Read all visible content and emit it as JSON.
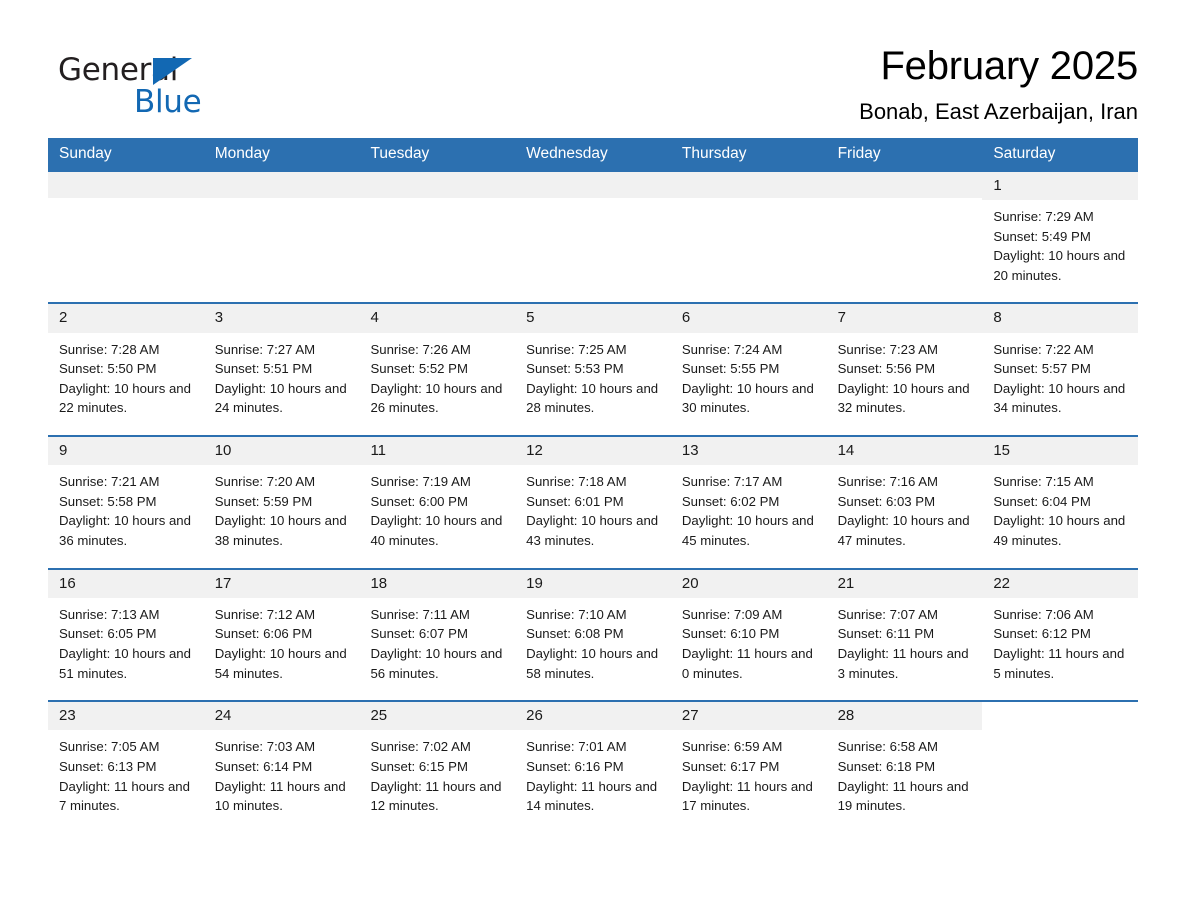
{
  "brand": {
    "name_part1": "General",
    "name_part2": "Blue",
    "triangle_icon": "triangle-icon",
    "accent_color": "#1268b3"
  },
  "header": {
    "title": "February 2025",
    "subtitle": "Bonab, East Azerbaijan, Iran"
  },
  "colors": {
    "header_blue": "#2c70b0",
    "day_number_band": "#f1f1f1",
    "text": "#1a1a1a"
  },
  "labels": {
    "sunrise_prefix": "Sunrise:",
    "sunset_prefix": "Sunset:",
    "daylight_prefix": "Daylight:"
  },
  "weekdays": [
    "Sunday",
    "Monday",
    "Tuesday",
    "Wednesday",
    "Thursday",
    "Friday",
    "Saturday"
  ],
  "weeks": [
    [
      {
        "day": "",
        "sunrise": "",
        "sunset": "",
        "daylight": ""
      },
      {
        "day": "",
        "sunrise": "",
        "sunset": "",
        "daylight": ""
      },
      {
        "day": "",
        "sunrise": "",
        "sunset": "",
        "daylight": ""
      },
      {
        "day": "",
        "sunrise": "",
        "sunset": "",
        "daylight": ""
      },
      {
        "day": "",
        "sunrise": "",
        "sunset": "",
        "daylight": ""
      },
      {
        "day": "",
        "sunrise": "",
        "sunset": "",
        "daylight": ""
      },
      {
        "day": "1",
        "sunrise": "Sunrise: 7:29 AM",
        "sunset": "Sunset: 5:49 PM",
        "daylight": "Daylight: 10 hours and 20 minutes."
      }
    ],
    [
      {
        "day": "2",
        "sunrise": "Sunrise: 7:28 AM",
        "sunset": "Sunset: 5:50 PM",
        "daylight": "Daylight: 10 hours and 22 minutes."
      },
      {
        "day": "3",
        "sunrise": "Sunrise: 7:27 AM",
        "sunset": "Sunset: 5:51 PM",
        "daylight": "Daylight: 10 hours and 24 minutes."
      },
      {
        "day": "4",
        "sunrise": "Sunrise: 7:26 AM",
        "sunset": "Sunset: 5:52 PM",
        "daylight": "Daylight: 10 hours and 26 minutes."
      },
      {
        "day": "5",
        "sunrise": "Sunrise: 7:25 AM",
        "sunset": "Sunset: 5:53 PM",
        "daylight": "Daylight: 10 hours and 28 minutes."
      },
      {
        "day": "6",
        "sunrise": "Sunrise: 7:24 AM",
        "sunset": "Sunset: 5:55 PM",
        "daylight": "Daylight: 10 hours and 30 minutes."
      },
      {
        "day": "7",
        "sunrise": "Sunrise: 7:23 AM",
        "sunset": "Sunset: 5:56 PM",
        "daylight": "Daylight: 10 hours and 32 minutes."
      },
      {
        "day": "8",
        "sunrise": "Sunrise: 7:22 AM",
        "sunset": "Sunset: 5:57 PM",
        "daylight": "Daylight: 10 hours and 34 minutes."
      }
    ],
    [
      {
        "day": "9",
        "sunrise": "Sunrise: 7:21 AM",
        "sunset": "Sunset: 5:58 PM",
        "daylight": "Daylight: 10 hours and 36 minutes."
      },
      {
        "day": "10",
        "sunrise": "Sunrise: 7:20 AM",
        "sunset": "Sunset: 5:59 PM",
        "daylight": "Daylight: 10 hours and 38 minutes."
      },
      {
        "day": "11",
        "sunrise": "Sunrise: 7:19 AM",
        "sunset": "Sunset: 6:00 PM",
        "daylight": "Daylight: 10 hours and 40 minutes."
      },
      {
        "day": "12",
        "sunrise": "Sunrise: 7:18 AM",
        "sunset": "Sunset: 6:01 PM",
        "daylight": "Daylight: 10 hours and 43 minutes."
      },
      {
        "day": "13",
        "sunrise": "Sunrise: 7:17 AM",
        "sunset": "Sunset: 6:02 PM",
        "daylight": "Daylight: 10 hours and 45 minutes."
      },
      {
        "day": "14",
        "sunrise": "Sunrise: 7:16 AM",
        "sunset": "Sunset: 6:03 PM",
        "daylight": "Daylight: 10 hours and 47 minutes."
      },
      {
        "day": "15",
        "sunrise": "Sunrise: 7:15 AM",
        "sunset": "Sunset: 6:04 PM",
        "daylight": "Daylight: 10 hours and 49 minutes."
      }
    ],
    [
      {
        "day": "16",
        "sunrise": "Sunrise: 7:13 AM",
        "sunset": "Sunset: 6:05 PM",
        "daylight": "Daylight: 10 hours and 51 minutes."
      },
      {
        "day": "17",
        "sunrise": "Sunrise: 7:12 AM",
        "sunset": "Sunset: 6:06 PM",
        "daylight": "Daylight: 10 hours and 54 minutes."
      },
      {
        "day": "18",
        "sunrise": "Sunrise: 7:11 AM",
        "sunset": "Sunset: 6:07 PM",
        "daylight": "Daylight: 10 hours and 56 minutes."
      },
      {
        "day": "19",
        "sunrise": "Sunrise: 7:10 AM",
        "sunset": "Sunset: 6:08 PM",
        "daylight": "Daylight: 10 hours and 58 minutes."
      },
      {
        "day": "20",
        "sunrise": "Sunrise: 7:09 AM",
        "sunset": "Sunset: 6:10 PM",
        "daylight": "Daylight: 11 hours and 0 minutes."
      },
      {
        "day": "21",
        "sunrise": "Sunrise: 7:07 AM",
        "sunset": "Sunset: 6:11 PM",
        "daylight": "Daylight: 11 hours and 3 minutes."
      },
      {
        "day": "22",
        "sunrise": "Sunrise: 7:06 AM",
        "sunset": "Sunset: 6:12 PM",
        "daylight": "Daylight: 11 hours and 5 minutes."
      }
    ],
    [
      {
        "day": "23",
        "sunrise": "Sunrise: 7:05 AM",
        "sunset": "Sunset: 6:13 PM",
        "daylight": "Daylight: 11 hours and 7 minutes."
      },
      {
        "day": "24",
        "sunrise": "Sunrise: 7:03 AM",
        "sunset": "Sunset: 6:14 PM",
        "daylight": "Daylight: 11 hours and 10 minutes."
      },
      {
        "day": "25",
        "sunrise": "Sunrise: 7:02 AM",
        "sunset": "Sunset: 6:15 PM",
        "daylight": "Daylight: 11 hours and 12 minutes."
      },
      {
        "day": "26",
        "sunrise": "Sunrise: 7:01 AM",
        "sunset": "Sunset: 6:16 PM",
        "daylight": "Daylight: 11 hours and 14 minutes."
      },
      {
        "day": "27",
        "sunrise": "Sunrise: 6:59 AM",
        "sunset": "Sunset: 6:17 PM",
        "daylight": "Daylight: 11 hours and 17 minutes."
      },
      {
        "day": "28",
        "sunrise": "Sunrise: 6:58 AM",
        "sunset": "Sunset: 6:18 PM",
        "daylight": "Daylight: 11 hours and 19 minutes."
      },
      {
        "day": "",
        "sunrise": "",
        "sunset": "",
        "daylight": ""
      }
    ]
  ]
}
